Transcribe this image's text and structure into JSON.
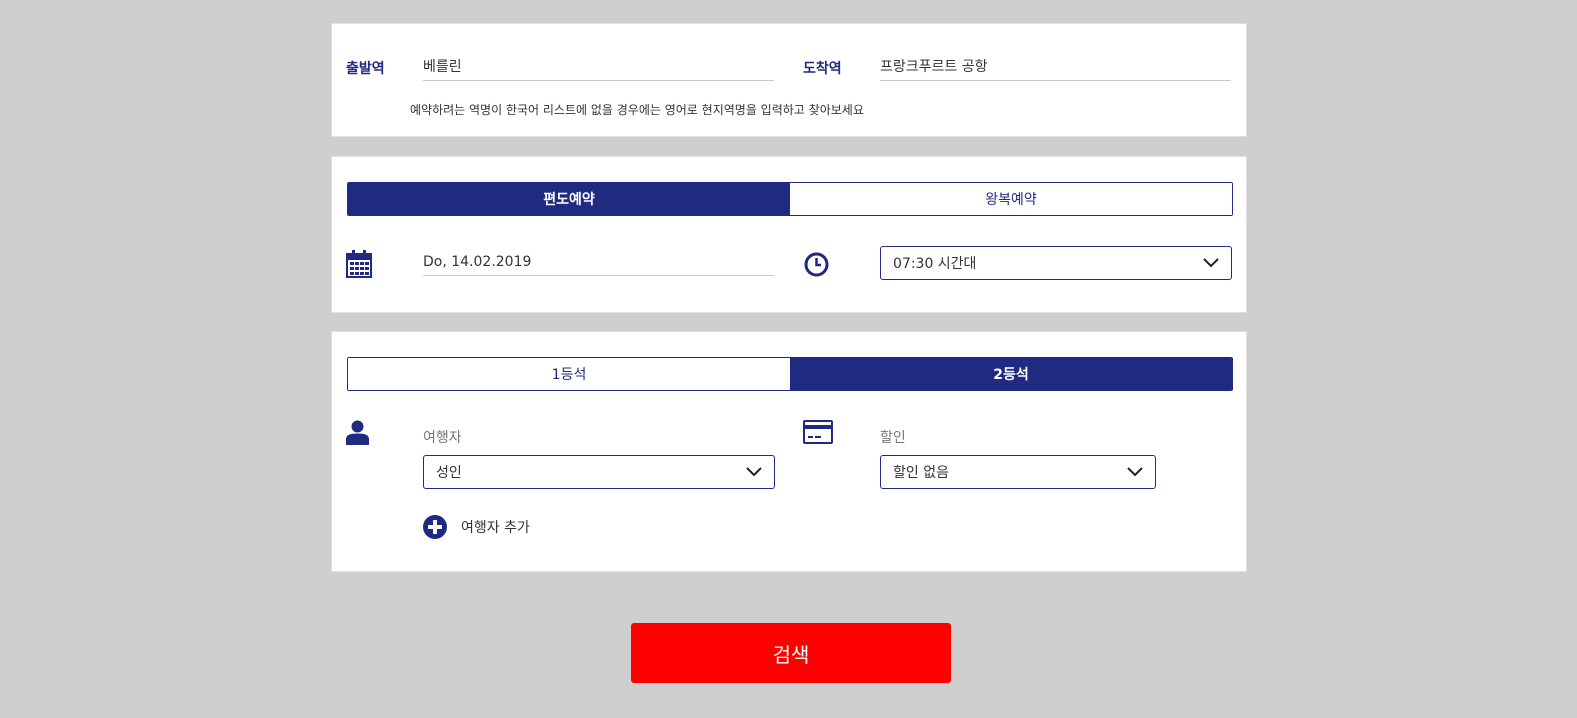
{
  "stations": {
    "departure_label": "출발역",
    "departure_value": "베를린",
    "arrival_label": "도착역",
    "arrival_value": "프랑크푸르트 공항",
    "hint": "예약하려는 역명이 한국어 리스트에 없을 경우에는 영어로 현지역명을 입력하고 찾아보세요"
  },
  "trip_type": {
    "options": [
      {
        "label": "편도예약",
        "active": true
      },
      {
        "label": "왕복예약",
        "active": false
      }
    ]
  },
  "datetime": {
    "date_value": "Do, 14.02.2019",
    "time_value": "07:30 시간대"
  },
  "class_type": {
    "options": [
      {
        "label": "1등석",
        "active": false
      },
      {
        "label": "2등석",
        "active": true
      }
    ]
  },
  "passengers": {
    "traveler_label": "여행자",
    "traveler_value": "성인",
    "discount_label": "할인",
    "discount_value": "할인 없음",
    "add_traveler_label": "여행자 추가"
  },
  "search": {
    "label": "검색"
  },
  "colors": {
    "brand": "#1f2a80",
    "cta": "#ff0000",
    "background": "#cfcfcf"
  },
  "icons": [
    "calendar-icon",
    "clock-icon",
    "person-icon",
    "credit-card-icon",
    "plus-circle-icon",
    "chevron-down-icon"
  ]
}
